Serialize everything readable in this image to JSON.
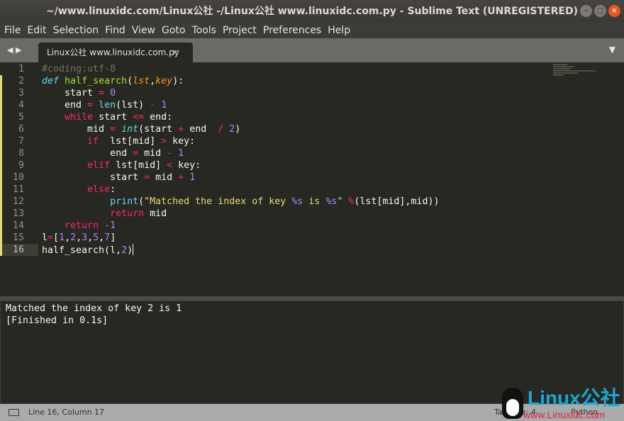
{
  "window": {
    "title": "~/www.linuxidc.com/Linux公社 -/Linux公社 www.linuxidc.com.py - Sublime Text (UNREGISTERED)",
    "buttons": [
      "–",
      "□",
      "×"
    ]
  },
  "menu": [
    "File",
    "Edit",
    "Selection",
    "Find",
    "View",
    "Goto",
    "Tools",
    "Project",
    "Preferences",
    "Help"
  ],
  "tab": {
    "label": "Linux公社 www.linuxidc.com.py",
    "close": "×",
    "nav": "◀ ▶",
    "menu": "▼"
  },
  "code": [
    [
      [
        "#coding:utf-8",
        "comment"
      ]
    ],
    [
      [
        "def",
        "def"
      ],
      [
        " ",
        ""
      ],
      [
        "half_search",
        "fn"
      ],
      [
        "(",
        ""
      ],
      [
        "lst",
        "param"
      ],
      [
        ",",
        ""
      ],
      [
        "key",
        "param"
      ],
      [
        "):",
        ""
      ]
    ],
    [
      [
        "    start ",
        ""
      ],
      [
        "=",
        "op"
      ],
      [
        " ",
        ""
      ],
      [
        "0",
        "num"
      ]
    ],
    [
      [
        "    end ",
        ""
      ],
      [
        "=",
        "op"
      ],
      [
        " ",
        ""
      ],
      [
        "len",
        "builtin"
      ],
      [
        "(lst) ",
        ""
      ],
      [
        "-",
        "op"
      ],
      [
        " ",
        ""
      ],
      [
        "1",
        "num"
      ]
    ],
    [
      [
        "    ",
        ""
      ],
      [
        "while",
        "op"
      ],
      [
        " start ",
        ""
      ],
      [
        "<=",
        "op"
      ],
      [
        " end:",
        ""
      ]
    ],
    [
      [
        "        mid ",
        ""
      ],
      [
        "=",
        "op"
      ],
      [
        " ",
        ""
      ],
      [
        "int",
        "type"
      ],
      [
        "(start ",
        ""
      ],
      [
        "+",
        "op"
      ],
      [
        " end  ",
        ""
      ],
      [
        "/",
        "op"
      ],
      [
        " ",
        ""
      ],
      [
        "2",
        "num"
      ],
      [
        ")",
        ""
      ]
    ],
    [
      [
        "        ",
        ""
      ],
      [
        "if",
        "op"
      ],
      [
        "  lst[mid] ",
        ""
      ],
      [
        ">",
        "op"
      ],
      [
        " key:",
        ""
      ]
    ],
    [
      [
        "            end ",
        ""
      ],
      [
        "=",
        "op"
      ],
      [
        " mid ",
        ""
      ],
      [
        "-",
        "op"
      ],
      [
        " ",
        ""
      ],
      [
        "1",
        "num"
      ]
    ],
    [
      [
        "        ",
        ""
      ],
      [
        "elif",
        "op"
      ],
      [
        " lst[mid] ",
        ""
      ],
      [
        "<",
        "op"
      ],
      [
        " key:",
        ""
      ]
    ],
    [
      [
        "            start ",
        ""
      ],
      [
        "=",
        "op"
      ],
      [
        " mid ",
        ""
      ],
      [
        "+",
        "op"
      ],
      [
        " ",
        ""
      ],
      [
        "1",
        "num"
      ]
    ],
    [
      [
        "        ",
        ""
      ],
      [
        "else",
        "op"
      ],
      [
        ":",
        ""
      ]
    ],
    [
      [
        "            ",
        ""
      ],
      [
        "print",
        "builtin"
      ],
      [
        "(",
        ""
      ],
      [
        "\"Matched the index of key ",
        "str"
      ],
      [
        "%s",
        "num"
      ],
      [
        " is ",
        "str"
      ],
      [
        "%s",
        "num"
      ],
      [
        "\"",
        "str"
      ],
      [
        " ",
        ""
      ],
      [
        "%",
        "op"
      ],
      [
        "(lst[mid],mid))",
        ""
      ]
    ],
    [
      [
        "            ",
        ""
      ],
      [
        "return",
        "op"
      ],
      [
        " mid",
        ""
      ]
    ],
    [
      [
        "    ",
        ""
      ],
      [
        "return",
        "op"
      ],
      [
        " ",
        ""
      ],
      [
        "-1",
        "num"
      ]
    ],
    [
      [
        "l",
        ""
      ],
      [
        "=",
        "op"
      ],
      [
        "[",
        ""
      ],
      [
        "1",
        "num"
      ],
      [
        ",",
        ""
      ],
      [
        "2",
        "num"
      ],
      [
        ",",
        ""
      ],
      [
        "3",
        "num"
      ],
      [
        ",",
        ""
      ],
      [
        "5",
        "num"
      ],
      [
        ",",
        ""
      ],
      [
        "7",
        "num"
      ],
      [
        "]",
        ""
      ]
    ],
    [
      [
        "half_search(l,",
        ""
      ],
      [
        "2",
        "num"
      ],
      [
        ")",
        ""
      ]
    ]
  ],
  "modified_lines": [
    2,
    3,
    4,
    5,
    6,
    7,
    8,
    9,
    10,
    11,
    12,
    13,
    14,
    15,
    16
  ],
  "current_line": 16,
  "output": [
    "Matched the index of key 2 is 1",
    "[Finished in 0.1s]"
  ],
  "status": {
    "position": "Line 16, Column 17",
    "right1": "Tab Size: 4",
    "right2": "Python"
  },
  "watermark": {
    "brand": "Linux公社",
    "url": "www.Linuxidc.com"
  }
}
